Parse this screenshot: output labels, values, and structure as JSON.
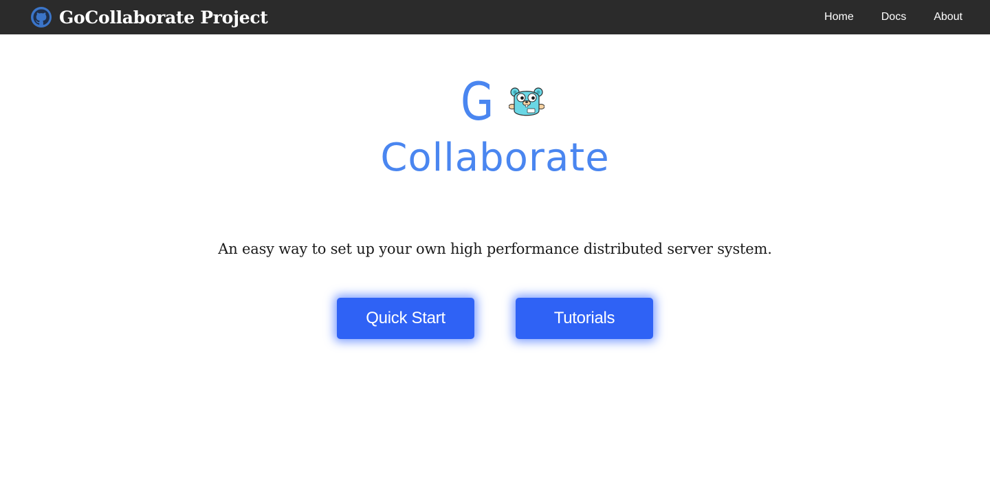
{
  "navbar": {
    "brand_icon": "github-icon",
    "brand_title": "GoCollaborate Project",
    "links": [
      {
        "label": "Home"
      },
      {
        "label": "Docs"
      },
      {
        "label": "About"
      }
    ],
    "colors": {
      "background": "#2b2b2b",
      "text": "#ffffff"
    }
  },
  "hero": {
    "logo": {
      "letter": "G",
      "mascot_icon": "go-gopher-icon",
      "word": "Collaborate",
      "color": "#4a86f0"
    },
    "tagline": "An easy way to set up your own high performance distributed server system.",
    "buttons": [
      {
        "label": "Quick Start",
        "color": "#2f62f5"
      },
      {
        "label": "Tutorials",
        "color": "#2f62f5"
      }
    ]
  }
}
